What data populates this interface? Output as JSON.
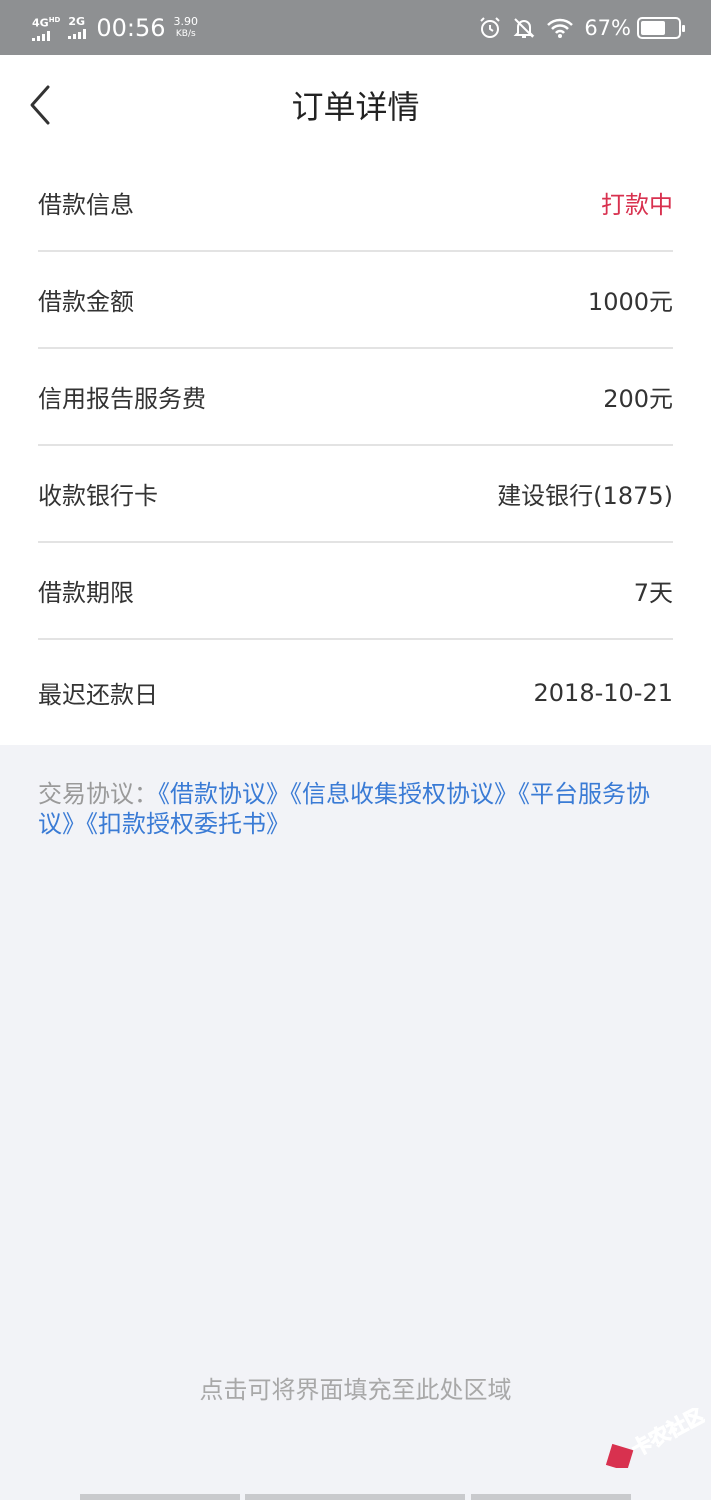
{
  "statusbar": {
    "net1": "4G",
    "net1_sup": "HD",
    "net2": "2G",
    "time": "00:56",
    "speed_value": "3.90",
    "speed_unit": "KB/s",
    "battery": "67%",
    "icons": [
      "alarm-icon",
      "bell-off-icon",
      "wifi-icon",
      "battery-icon"
    ]
  },
  "navbar": {
    "title": "订单详情",
    "back_icon": "chevron-left-icon"
  },
  "details": [
    {
      "label": "借款信息",
      "value": "打款中"
    },
    {
      "label": "借款金额",
      "value": "1000元"
    },
    {
      "label": "信用报告服务费",
      "value": "200元"
    },
    {
      "label": "收款银行卡",
      "value": "建设银行(1875)"
    },
    {
      "label": "借款期限",
      "value": "7天"
    },
    {
      "label": "最迟还款日",
      "value": "2018-10-21"
    }
  ],
  "agreement": {
    "prefix": "交易协议：",
    "links": [
      "《借款协议》",
      "《信息收集授权协议》",
      "《平台服务协议》",
      "《扣款授权委托书》"
    ]
  },
  "fill_hint": "点击可将界面填充至此处区域",
  "watermark": "卡农社区",
  "colors": {
    "status_red": "#d8314f",
    "link_blue": "#3a7bd5",
    "statusbar_bg": "#8e9092",
    "page_bg": "#f2f3f7"
  }
}
